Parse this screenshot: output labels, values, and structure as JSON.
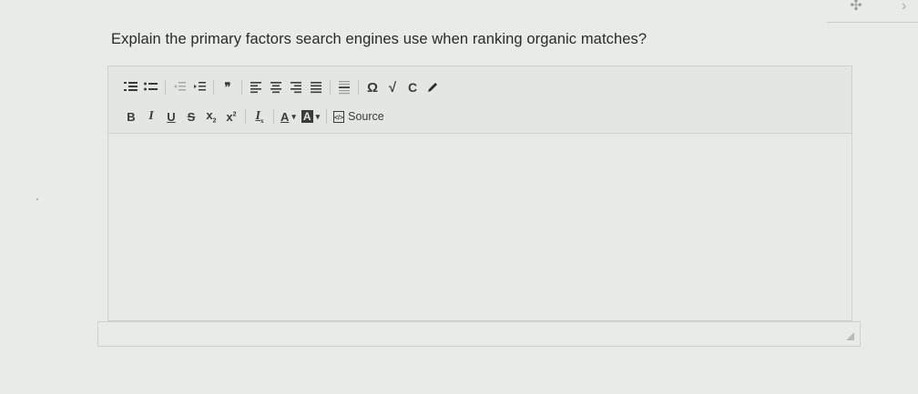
{
  "question": {
    "text": "Explain the primary factors search engines use when ranking organic matches?"
  },
  "toolbar": {
    "row1": [
      {
        "name": "numbered-list-icon"
      },
      {
        "name": "bulleted-list-icon"
      },
      {
        "name": "decrease-indent-icon"
      },
      {
        "name": "increase-indent-icon"
      },
      {
        "name": "blockquote-icon",
        "glyph": "❞"
      },
      {
        "name": "align-left-icon"
      },
      {
        "name": "align-center-icon"
      },
      {
        "name": "align-right-icon"
      },
      {
        "name": "justify-icon"
      },
      {
        "name": "horizontal-line-icon"
      },
      {
        "name": "special-character-icon",
        "glyph": "Ω"
      },
      {
        "name": "math-icon",
        "glyph": "√"
      },
      {
        "name": "c-icon",
        "glyph": "C"
      },
      {
        "name": "pencil-icon"
      }
    ],
    "row2": {
      "bold": "B",
      "italic": "I",
      "underline": "U",
      "strike": "S",
      "subscript": "x",
      "superscript": "x",
      "remove_format": "I",
      "text_color": "A",
      "bg_color": "A",
      "source_label": "Source"
    }
  },
  "editor": {
    "content": ""
  }
}
